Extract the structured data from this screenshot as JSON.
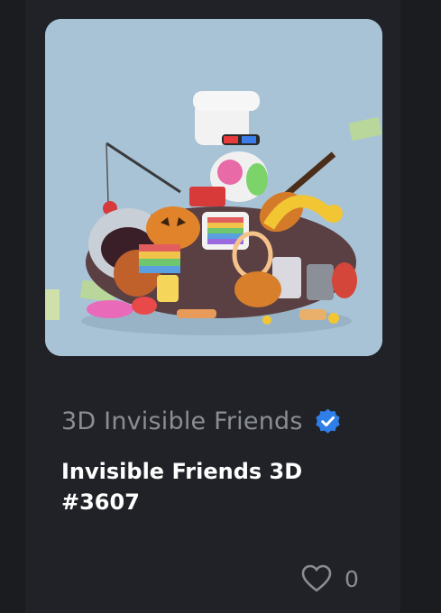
{
  "card": {
    "image_alt": "3D Invisible Friends artwork: a pile of colourful toys and objects on a light blue background",
    "collection_name": "3D Invisible Friends",
    "verified_icon": "verified-badge-icon",
    "token_name": "Invisible Friends 3D #3607",
    "like_icon": "heart-outline-icon",
    "like_count": "0"
  },
  "colors": {
    "background": "#1b1c20",
    "card": "#202227",
    "image_background": "#a9c3d6",
    "verified_badge": "#2f7fe8",
    "muted_text": "#8a8d93",
    "title_text": "#ffffff"
  }
}
